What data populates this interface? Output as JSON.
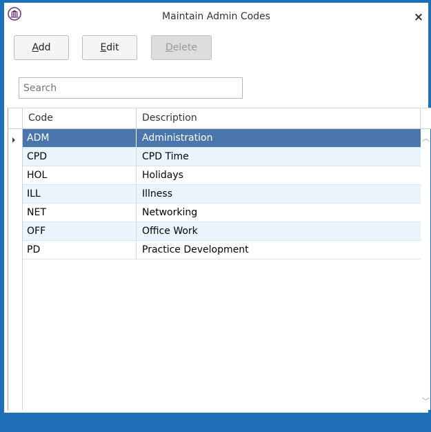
{
  "window": {
    "title": "Maintain Admin Codes",
    "close_glyph": "✕",
    "logo_icon": "institution-icon"
  },
  "toolbar": {
    "add": {
      "mnemonic": "A",
      "rest": "dd"
    },
    "edit": {
      "mnemonic": "E",
      "rest": "dit"
    },
    "delete": {
      "mnemonic": "D",
      "rest": "elete",
      "disabled": true
    }
  },
  "search": {
    "placeholder": "Search",
    "value": ""
  },
  "grid": {
    "columns": [
      "Code",
      "Description"
    ],
    "rows": [
      {
        "code": "ADM",
        "description": "Administration",
        "selected": true
      },
      {
        "code": "CPD",
        "description": "CPD Time"
      },
      {
        "code": "HOL",
        "description": "Holidays"
      },
      {
        "code": "ILL",
        "description": "Illness"
      },
      {
        "code": "NET",
        "description": "Networking"
      },
      {
        "code": "OFF",
        "description": "Office Work"
      },
      {
        "code": "PD",
        "description": "Practice Development"
      }
    ]
  },
  "colors": {
    "accent": "#1e6fb8",
    "selected_row": "#4b76ab",
    "alt_row": "#eaf4fc"
  }
}
